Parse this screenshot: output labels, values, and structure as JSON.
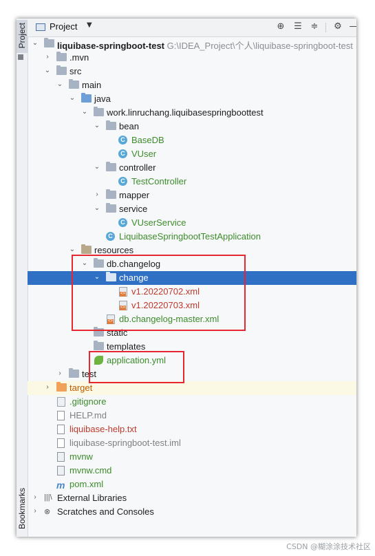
{
  "side_strip": {
    "project_label": "Project",
    "bookmarks_label": "Bookmarks"
  },
  "header": {
    "title": "Project",
    "icons": [
      "crosshair-icon",
      "expand-all-icon",
      "collapse-all-icon",
      "gear-icon",
      "hide-icon"
    ]
  },
  "tree": [
    {
      "label": "liquibase-springboot-test",
      "path": "G:\\IDEA_Project\\个人\\liquibase-springboot-test",
      "icon": "module-folder-icon",
      "chev": "down"
    },
    {
      "label": ".mvn",
      "icon": "folder-icon",
      "chev": "right"
    },
    {
      "label": "src",
      "icon": "folder-icon",
      "chev": "down"
    },
    {
      "label": "main",
      "icon": "folder-icon",
      "chev": "down"
    },
    {
      "label": "java",
      "icon": "source-folder-icon",
      "chev": "down"
    },
    {
      "label": "work.linruchang.liquibasespringboottest",
      "icon": "package-icon",
      "chev": "down"
    },
    {
      "label": "bean",
      "icon": "package-icon",
      "chev": "down"
    },
    {
      "label": "BaseDB",
      "icon": "class-icon",
      "chev": ""
    },
    {
      "label": "VUser",
      "icon": "class-icon",
      "chev": ""
    },
    {
      "label": "controller",
      "icon": "package-icon",
      "chev": "down"
    },
    {
      "label": "TestController",
      "icon": "class-icon",
      "chev": ""
    },
    {
      "label": "mapper",
      "icon": "package-icon",
      "chev": "right"
    },
    {
      "label": "service",
      "icon": "package-icon",
      "chev": "down"
    },
    {
      "label": "VUserService",
      "icon": "class-icon",
      "chev": ""
    },
    {
      "label": "LiquibaseSpringbootTestApplication",
      "icon": "spring-class-icon",
      "chev": ""
    },
    {
      "label": "resources",
      "icon": "resources-folder-icon",
      "chev": "down"
    },
    {
      "label": "db.changelog",
      "icon": "folder-icon",
      "chev": "down"
    },
    {
      "label": "change",
      "icon": "folder-icon",
      "chev": "down",
      "selected": true
    },
    {
      "label": "v1.20220702.xml",
      "icon": "xml-file-icon",
      "chev": ""
    },
    {
      "label": "v1.20220703.xml",
      "icon": "xml-file-icon",
      "chev": ""
    },
    {
      "label": "db.changelog-master.xml",
      "icon": "xml-file-icon",
      "chev": ""
    },
    {
      "label": "static",
      "icon": "folder-icon",
      "chev": ""
    },
    {
      "label": "templates",
      "icon": "folder-icon",
      "chev": ""
    },
    {
      "label": "application.yml",
      "icon": "spring-leaf-icon",
      "chev": ""
    },
    {
      "label": "test",
      "icon": "folder-icon",
      "chev": "right"
    },
    {
      "label": "target",
      "icon": "excluded-folder-icon",
      "chev": "right"
    },
    {
      "label": ".gitignore",
      "icon": "gitignore-file-icon",
      "chev": ""
    },
    {
      "label": "HELP.md",
      "icon": "markdown-file-icon",
      "chev": ""
    },
    {
      "label": "liquibase-help.txt",
      "icon": "text-file-icon",
      "chev": ""
    },
    {
      "label": "liquibase-springboot-test.iml",
      "icon": "iml-file-icon",
      "chev": ""
    },
    {
      "label": "mvnw",
      "icon": "script-file-icon",
      "chev": ""
    },
    {
      "label": "mvnw.cmd",
      "icon": "script-file-icon",
      "chev": ""
    },
    {
      "label": "pom.xml",
      "icon": "maven-icon",
      "chev": ""
    },
    {
      "label": "External Libraries",
      "icon": "libraries-icon",
      "chev": "right"
    },
    {
      "label": "Scratches and Consoles",
      "icon": "scratches-icon",
      "chev": "right"
    }
  ],
  "colors": {
    "selection": "#2f6fc4",
    "annotation": "#e8262f",
    "vcs_added": "#3c8c2a",
    "vcs_modified": "#bd5a00",
    "vcs_unversioned": "#c0392b"
  },
  "watermark": "CSDN @糊涂涂技术社区"
}
